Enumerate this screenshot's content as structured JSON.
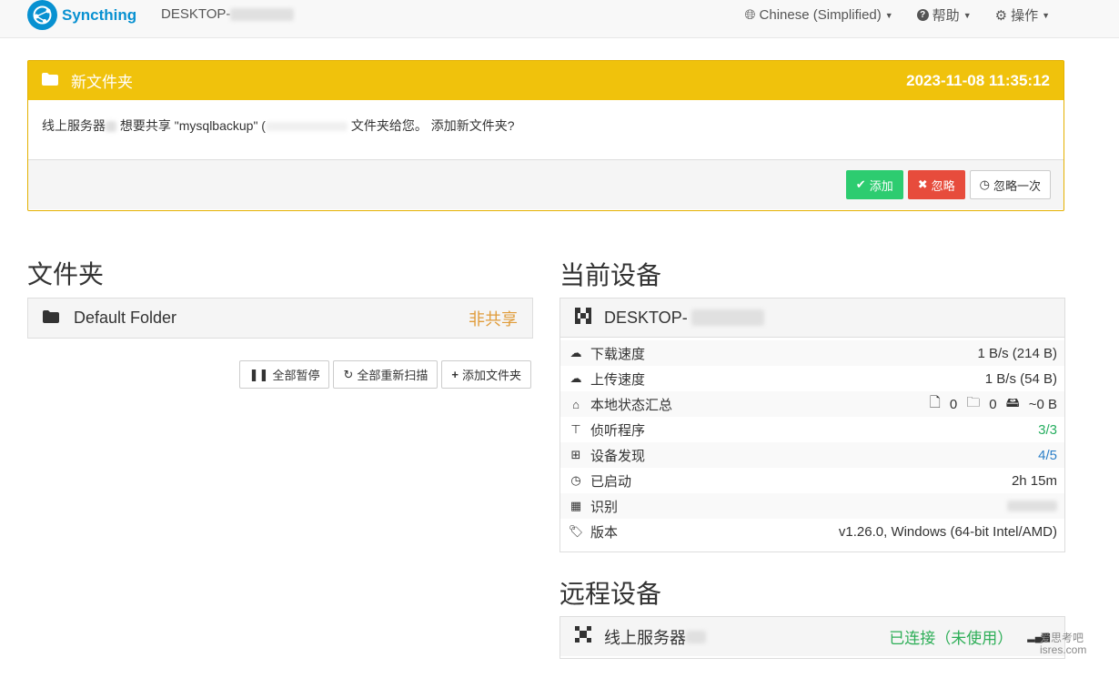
{
  "navbar": {
    "brand": "Syncthing",
    "hostname": "DESKTOP-",
    "language": "Chinese (Simplified)",
    "help": "帮助",
    "actions": "操作"
  },
  "notice": {
    "title": "新文件夹",
    "timestamp": "2023-11-08 11:35:12",
    "message_part1": "线上服务器",
    "message_part2": " 想要共享 \"mysqlbackup\" (",
    "message_part3": " 文件夹给您。 添加新文件夹?",
    "btn_add": "添加",
    "btn_ignore": "忽略",
    "btn_ignore_once": "忽略一次"
  },
  "folders": {
    "heading": "文件夹",
    "items": [
      {
        "name": "Default Folder",
        "status": "非共享"
      }
    ],
    "btn_pause_all": "全部暂停",
    "btn_rescan_all": "全部重新扫描",
    "btn_add_folder": "添加文件夹"
  },
  "this_device": {
    "heading": "当前设备",
    "name": "DESKTOP-",
    "stats": [
      {
        "label": "下载速度",
        "value": "1 B/s (214 B)",
        "icon": "cloud-download-icon"
      },
      {
        "label": "上传速度",
        "value": "1 B/s (54 B)",
        "icon": "cloud-upload-icon"
      },
      {
        "label": "本地状态汇总",
        "value": "",
        "icon": "home-icon"
      },
      {
        "label": "侦听程序",
        "value": "3/3",
        "icon": "sitemap-icon"
      },
      {
        "label": "设备发现",
        "value": "4/5",
        "icon": "signpost-icon"
      },
      {
        "label": "已启动",
        "value": "2h 15m",
        "icon": "clock-icon"
      },
      {
        "label": "识别",
        "value": "",
        "icon": "qrcode-icon"
      },
      {
        "label": "版本",
        "value": "v1.26.0, Windows (64-bit Intel/AMD)",
        "icon": "tag-icon"
      }
    ],
    "local_state": {
      "files": "0",
      "dirs": "0",
      "size": "~0 B"
    }
  },
  "remote": {
    "heading": "远程设备",
    "name": "线上服务器",
    "status": "已连接（未使用）"
  },
  "watermark": {
    "line1": "爱思考吧",
    "line2": "isres.com"
  },
  "colors": {
    "brand": "#0891d1",
    "warning": "#f0c20c",
    "success": "#2dcc70",
    "danger": "#e74c3c"
  }
}
